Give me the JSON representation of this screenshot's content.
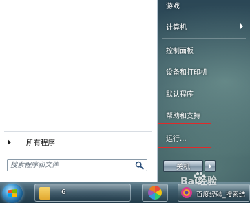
{
  "start_menu": {
    "all_programs_label": "所有程序",
    "search_placeholder": "搜索程序和文件",
    "right_items": [
      {
        "label": "游戏",
        "has_submenu": false
      },
      {
        "label": "计算机",
        "has_submenu": true
      },
      {
        "label": "控制面板",
        "has_submenu": false
      },
      {
        "label": "设备和打印机",
        "has_submenu": false
      },
      {
        "label": "默认程序",
        "has_submenu": false
      },
      {
        "label": "帮助和支持",
        "has_submenu": false
      },
      {
        "label": "运行...",
        "has_submenu": false
      }
    ],
    "shutdown_label": "关机",
    "highlight_color": "#e02a2a"
  },
  "taskbar": {
    "folder_button_label": "6",
    "browser_button_label": "百度经验_搜索结",
    "icons": [
      "start-orb-icon",
      "folder-icon",
      "color-wheel-icon",
      "browser-icon"
    ]
  },
  "watermark": {
    "text": "Bai经验",
    "subtext": "jingyan.baidu.com"
  }
}
